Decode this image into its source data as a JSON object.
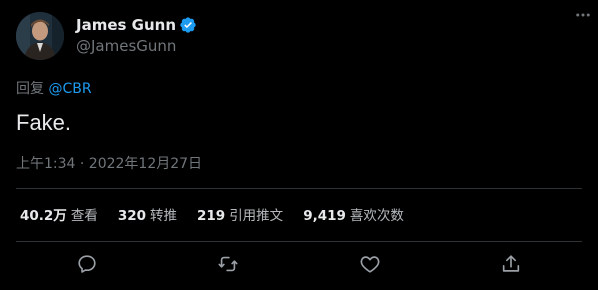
{
  "author": {
    "display_name": "James Gunn",
    "handle": "@JamesGunn",
    "verified": true,
    "verified_color": "#1d9bf0"
  },
  "reply": {
    "prefix": "回复",
    "mention": "@CBR"
  },
  "tweet": {
    "text": "Fake.",
    "timestamp": "上午1:34 · 2022年12月27日"
  },
  "stats": [
    {
      "value": "40.2万",
      "label": "查看"
    },
    {
      "value": "320",
      "label": "转推"
    },
    {
      "value": "219",
      "label": "引用推文"
    },
    {
      "value": "9,419",
      "label": "喜欢次数"
    }
  ],
  "actions": {
    "reply_icon": "reply-icon",
    "retweet_icon": "retweet-icon",
    "like_icon": "heart-icon",
    "share_icon": "share-icon"
  },
  "colors": {
    "background": "#000000",
    "text_primary": "#e7e9ea",
    "text_secondary": "#71767b",
    "accent": "#1d9bf0",
    "divider": "#2f3336"
  }
}
